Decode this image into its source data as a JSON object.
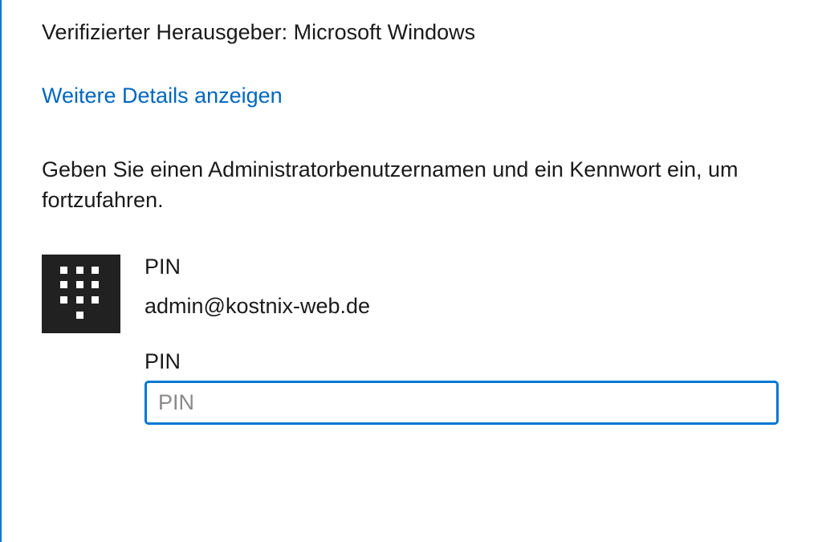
{
  "dialog": {
    "publisher_label": "Verifizierter Herausgeber: Microsoft Windows",
    "details_link": "Weitere Details anzeigen",
    "instruction": "Geben Sie einen Administratorbenutzernamen und ein Kennwort ein, um fortzufahren.",
    "credential": {
      "method_label": "PIN",
      "username": "admin@kostnix-web.de",
      "input_label": "PIN",
      "input_placeholder": "PIN",
      "input_value": ""
    }
  },
  "colors": {
    "accent": "#0078d4",
    "link": "#0067c0",
    "text": "#1a1a1a",
    "icon_bg": "#212121"
  }
}
